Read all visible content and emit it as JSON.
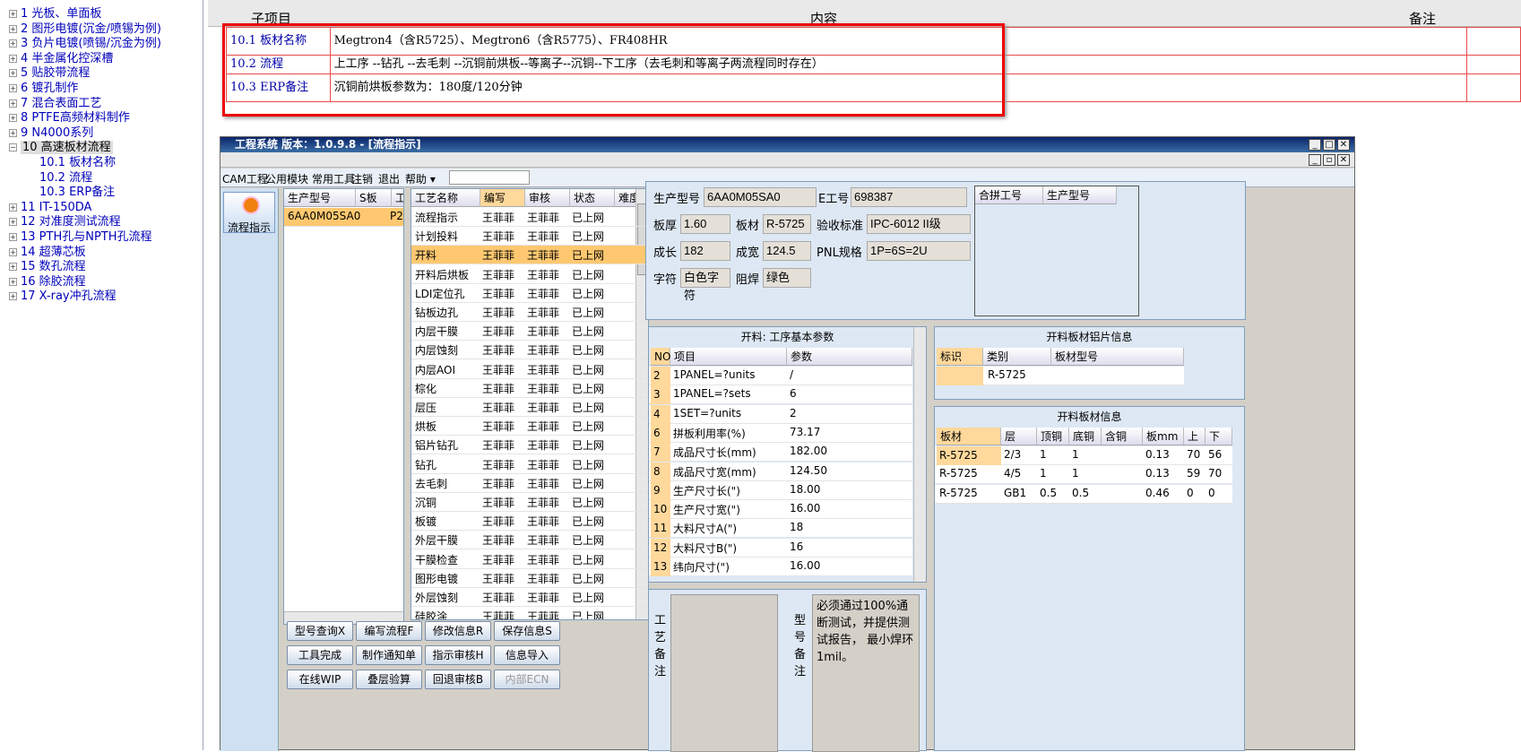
{
  "tree": {
    "items": [
      {
        "label": "1 光板、单面板",
        "pm": "+"
      },
      {
        "label": "2 图形电镀(沉金/喷锡为例)",
        "pm": "+"
      },
      {
        "label": "3 负片电镀(喷锡/沉金为例)",
        "pm": "+"
      },
      {
        "label": "4 半金属化控深槽",
        "pm": "+"
      },
      {
        "label": "5 贴胶带流程",
        "pm": "+"
      },
      {
        "label": "6 镀孔制作",
        "pm": "+"
      },
      {
        "label": "7 混合表面工艺",
        "pm": "+"
      },
      {
        "label": "8 PTFE高频材料制作",
        "pm": "+"
      },
      {
        "label": "9 N4000系列",
        "pm": "+"
      },
      {
        "label": "10 高速板材流程",
        "pm": "−"
      },
      {
        "label": "10.1 板材名称",
        "sub": true
      },
      {
        "label": "10.2 流程",
        "sub": true
      },
      {
        "label": "10.3 ERP备注",
        "sub": true
      },
      {
        "label": "11 IT-150DA",
        "pm": "+"
      },
      {
        "label": "12 对准度测试流程",
        "pm": "+"
      },
      {
        "label": "13 PTH孔与NPTH孔流程",
        "pm": "+"
      },
      {
        "label": "14 超薄芯板",
        "pm": "+"
      },
      {
        "label": "15 数孔流程",
        "pm": "+"
      },
      {
        "label": "16 除胶流程",
        "pm": "+"
      },
      {
        "label": "17 X-ray冲孔流程",
        "pm": "+"
      }
    ]
  },
  "doc": {
    "headers": [
      "子项目",
      "内容",
      "备注"
    ],
    "rows": [
      {
        "sub": "10.1 板材名称",
        "content": "Megtron4（含R5725）、Megtron6（含R5775）、FR408HR"
      },
      {
        "sub": "10.2 流程",
        "content": "上工序 --钻孔 --去毛刺 --沉铜前烘板--等离子--沉铜--下工序（去毛刺和等离子两流程同时存在）"
      },
      {
        "sub": "10.3 ERP备注",
        "content": "沉铜前烘板参数为：180度/120分钟"
      }
    ]
  },
  "app": {
    "title": "工程系统    版本：1.0.9.8 - [流程指示]",
    "menu": [
      "CAM工程",
      "公用模块",
      "常用工具",
      "注销",
      "退出",
      "帮助 ▾"
    ],
    "flow_btn": "流程指示",
    "model_grid": {
      "headers": [
        "生产型号",
        "S板",
        "工厂"
      ],
      "row": [
        "6AA0M05SA0",
        "",
        "P2"
      ]
    },
    "process_grid": {
      "headers": [
        "工艺名称",
        "编写",
        "审核",
        "状态",
        "难度"
      ],
      "rows": [
        [
          "流程指示",
          "王菲菲",
          "王菲菲",
          "已上网"
        ],
        [
          "计划投料",
          "王菲菲",
          "王菲菲",
          "已上网"
        ],
        [
          "开料",
          "王菲菲",
          "王菲菲",
          "已上网"
        ],
        [
          "开料后烘板",
          "王菲菲",
          "王菲菲",
          "已上网"
        ],
        [
          "LDI定位孔",
          "王菲菲",
          "王菲菲",
          "已上网"
        ],
        [
          "钻板边孔",
          "王菲菲",
          "王菲菲",
          "已上网"
        ],
        [
          "内层干膜",
          "王菲菲",
          "王菲菲",
          "已上网"
        ],
        [
          "内层蚀刻",
          "王菲菲",
          "王菲菲",
          "已上网"
        ],
        [
          "内层AOI",
          "王菲菲",
          "王菲菲",
          "已上网"
        ],
        [
          "棕化",
          "王菲菲",
          "王菲菲",
          "已上网"
        ],
        [
          "层压",
          "王菲菲",
          "王菲菲",
          "已上网"
        ],
        [
          "烘板",
          "王菲菲",
          "王菲菲",
          "已上网"
        ],
        [
          "铝片钻孔",
          "王菲菲",
          "王菲菲",
          "已上网"
        ],
        [
          "钻孔",
          "王菲菲",
          "王菲菲",
          "已上网"
        ],
        [
          "去毛刺",
          "王菲菲",
          "王菲菲",
          "已上网"
        ],
        [
          "沉铜",
          "王菲菲",
          "王菲菲",
          "已上网"
        ],
        [
          "板镀",
          "王菲菲",
          "王菲菲",
          "已上网"
        ],
        [
          "外层干膜",
          "王菲菲",
          "王菲菲",
          "已上网"
        ],
        [
          "干膜检查",
          "王菲菲",
          "王菲菲",
          "已上网"
        ],
        [
          "图形电镀",
          "王菲菲",
          "王菲菲",
          "已上网"
        ],
        [
          "外层蚀刻",
          "王菲菲",
          "王菲菲",
          "已上网"
        ],
        [
          "硅胶涂",
          "王菲菲",
          "王菲菲",
          "已上网"
        ]
      ]
    },
    "buttons": [
      "型号查询X",
      "编写流程F",
      "修改信息R",
      "保存信息S",
      "工具完成",
      "制作通知单",
      "指示审核H",
      "信息导入",
      "在线WIP",
      "叠层验算",
      "回退审核B",
      "内部ECN"
    ],
    "info": {
      "lbl_model": "生产型号",
      "model": "6AA0M05SA0",
      "lbl_e": "E工号",
      "e": "698387",
      "lbl_thick": "板厚",
      "thick": "1.60",
      "lbl_mat": "板材",
      "mat": "R-5725",
      "lbl_std": "验收标准",
      "std": "IPC-6012 II级",
      "lbl_len": "成长",
      "len": "182",
      "lbl_wid": "成宽",
      "wid": "124.5",
      "lbl_pnl": "PNL规格",
      "pnl": "1P=6S=2U",
      "lbl_char": "字符",
      "char": "白色字符",
      "lbl_mask": "阻焊",
      "mask": "绿色",
      "merge_headers": [
        "合拼工号",
        "生产型号"
      ]
    },
    "cut": {
      "title": "开料: 工序基本参数",
      "headers": [
        "NO",
        "项目",
        "参数"
      ],
      "rows": [
        [
          "2",
          "1PANEL=?units",
          "/"
        ],
        [
          "3",
          "1PANEL=?sets",
          "6"
        ],
        [
          "4",
          "1SET=?units",
          "2"
        ],
        [
          "6",
          "拼板利用率(%)",
          "73.17"
        ],
        [
          "7",
          "成品尺寸长(mm)",
          "182.00"
        ],
        [
          "8",
          "成品尺寸宽(mm)",
          "124.50"
        ],
        [
          "9",
          "生产尺寸长(\")",
          "18.00"
        ],
        [
          "10",
          "生产尺寸宽(\")",
          "16.00"
        ],
        [
          "11",
          "大料尺寸A(\")",
          "18"
        ],
        [
          "12",
          "大料尺寸B(\")",
          "16"
        ],
        [
          "13",
          "纬向尺寸(\")",
          "16.00"
        ]
      ]
    },
    "alu": {
      "title": "开料板材铝片信息",
      "headers": [
        "标识",
        "类别",
        "板材型号"
      ],
      "row": [
        "",
        "R-5725",
        ""
      ]
    },
    "board": {
      "title": "开料板材信息",
      "headers": [
        "板材",
        "层",
        "顶铜",
        "底铜",
        "含铜mm",
        "板mm",
        "上",
        "下"
      ],
      "rows": [
        [
          "R-5725",
          "2/3",
          "1",
          "1",
          "",
          "0.13",
          "70",
          "56"
        ],
        [
          "R-5725",
          "4/5",
          "1",
          "1",
          "",
          "0.13",
          "59",
          "70"
        ],
        [
          "R-5725",
          "GB1",
          "0.5",
          "0.5",
          "",
          "0.46",
          "0",
          "0"
        ]
      ]
    },
    "notes": {
      "craft_label": "工艺备注",
      "model_label": "型号备注",
      "model_text": "必须通过100%通断测试，并提供测试报告， 最小焊环1mil。"
    }
  }
}
